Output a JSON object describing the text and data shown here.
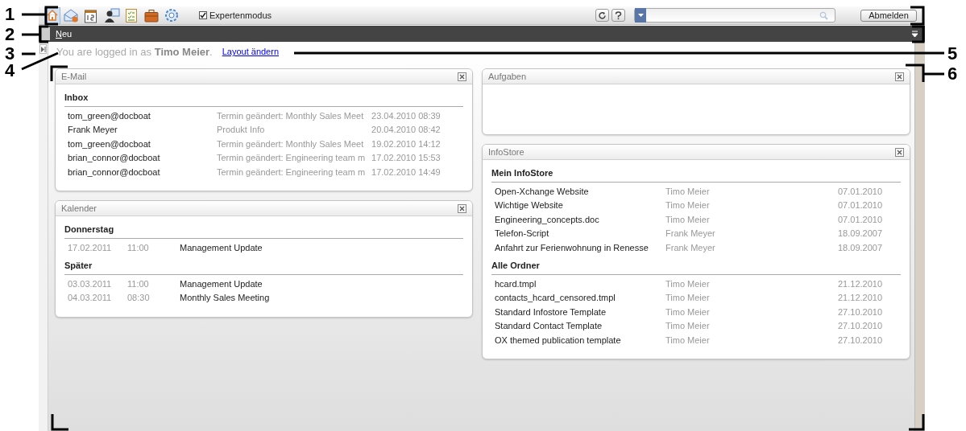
{
  "callouts": [
    {
      "number": "1"
    },
    {
      "number": "2"
    },
    {
      "number": "3"
    },
    {
      "number": "4"
    },
    {
      "number": "5"
    },
    {
      "number": "6"
    }
  ],
  "toolbar": {
    "expert_mode": {
      "label": "Expertenmodus",
      "checked": true
    },
    "logout_button": "Abmelden"
  },
  "menubar": {
    "new_label": "Neu"
  },
  "login_text": "You are logged in as **Timo Meier**.",
  "layout_link": "Layout ändern",
  "left_column": [
    {
      "title": "E-Mail",
      "kind": "email",
      "sections": [
        {
          "heading": "Inbox",
          "rows": [
            [
              "tom_green@docboat",
              "Termin geändert: Monthly Sales Meet",
              "23.04.2010 08:39"
            ],
            [
              "Frank Meyer",
              "Produkt Info",
              "20.04.2010 08:42"
            ],
            [
              "tom_green@docboat",
              "Termin geändert: Monthly Sales Meet",
              "19.02.2010 14:12"
            ],
            [
              "brian_connor@docboat",
              "Termin geändert: Engineering team m",
              "17.02.2010 15:53"
            ],
            [
              "brian_connor@docboat",
              "Termin geändert: Engineering team m",
              "17.02.2010 14:49"
            ]
          ]
        }
      ]
    },
    {
      "title": "Kalender",
      "kind": "calendar",
      "sections": [
        {
          "heading": "Donnerstag",
          "rows": [
            [
              "17.02.2011",
              "11:00",
              "Management Update"
            ]
          ]
        },
        {
          "heading": "Später",
          "rows": [
            [
              "03.03.2011",
              "11:00",
              "Management Update"
            ],
            [
              "04.03.2011",
              "08:30",
              "Monthly Sales Meeting"
            ]
          ]
        }
      ]
    }
  ],
  "right_column": [
    {
      "title": "Aufgaben",
      "kind": "tasks"
    },
    {
      "title": "InfoStore",
      "kind": "files",
      "sections": [
        {
          "heading": "Mein InfoStore",
          "rows": [
            [
              "Open-Xchange Website",
              "Timo Meier",
              "07.01.2010"
            ],
            [
              "Wichtige Website",
              "Timo Meier",
              "07.01.2010"
            ],
            [
              "Engineering_concepts.doc",
              "Timo Meier",
              "07.01.2010"
            ],
            [
              "Telefon-Script",
              "Frank Meyer",
              "18.09.2007"
            ],
            [
              "Anfahrt zur Ferienwohnung in Renesse",
              "Frank Meyer",
              "18.09.2007"
            ]
          ]
        },
        {
          "heading": "Alle Ordner",
          "rows": [
            [
              "hcard.tmpl",
              "Timo Meier",
              "21.12.2010"
            ],
            [
              "contacts_hcard_censored.tmpl",
              "Timo Meier",
              "21.12.2010"
            ],
            [
              "Standard Infostore Template",
              "Timo Meier",
              "27.10.2010"
            ],
            [
              "Standard Contact Template",
              "Timo Meier",
              "27.10.2010"
            ],
            [
              "OX themed publication template",
              "Timo Meier",
              "27.10.2010"
            ]
          ]
        }
      ]
    }
  ]
}
